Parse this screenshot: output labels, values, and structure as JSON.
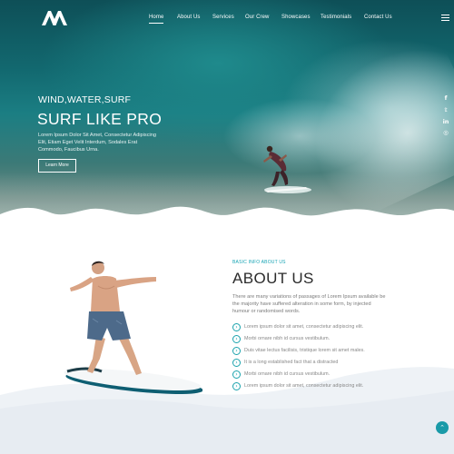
{
  "nav": {
    "items": [
      {
        "label": "Home",
        "active": true
      },
      {
        "label": "About Us"
      },
      {
        "label": "Services"
      },
      {
        "label": "Our Crew"
      },
      {
        "label": "Showcases"
      },
      {
        "label": "Testimonials"
      },
      {
        "label": "Contact Us"
      }
    ]
  },
  "hero": {
    "kicker": "WIND,WATER,SURF",
    "title": "SURF LIKE PRO",
    "description": "Lorem Ipsum Dolor Sit Amet, Consectetur Adipiscing Elit, Etiam Eget Velit Interdum, Sodales Erat Commodo, Faucibus Urna.",
    "button_label": "Learn More"
  },
  "social": {
    "facebook": "f",
    "twitter": "𝕥",
    "linkedin": "in",
    "instagram": "◎"
  },
  "about": {
    "kicker": "BASIC INFO ABOUT US",
    "title": "ABOUT US",
    "text": "There are many variations of passages of Lorem Ipsum available be the majority have suffered alteration in some form, by injected humour or randomised words.",
    "features": [
      "Lorem ipsum dolor sit amet, consectetur adipiscing elit.",
      "Morbi ornare nibh id cursus vestibulum.",
      "Duis vitae lectus facilisis, tristique lorem sit amet males.",
      "It is a long established fact that a distracted",
      "Morbi ornare nibh id cursus vestibulum.",
      "Lorem ipsum dolor sit amet, consectetur adipiscing elit."
    ]
  },
  "back_to_top_icon": "chevron-up-icon",
  "colors": {
    "accent": "#17a4b4",
    "hero_dark": "#0e4f57",
    "heading": "#2b2b2b"
  }
}
